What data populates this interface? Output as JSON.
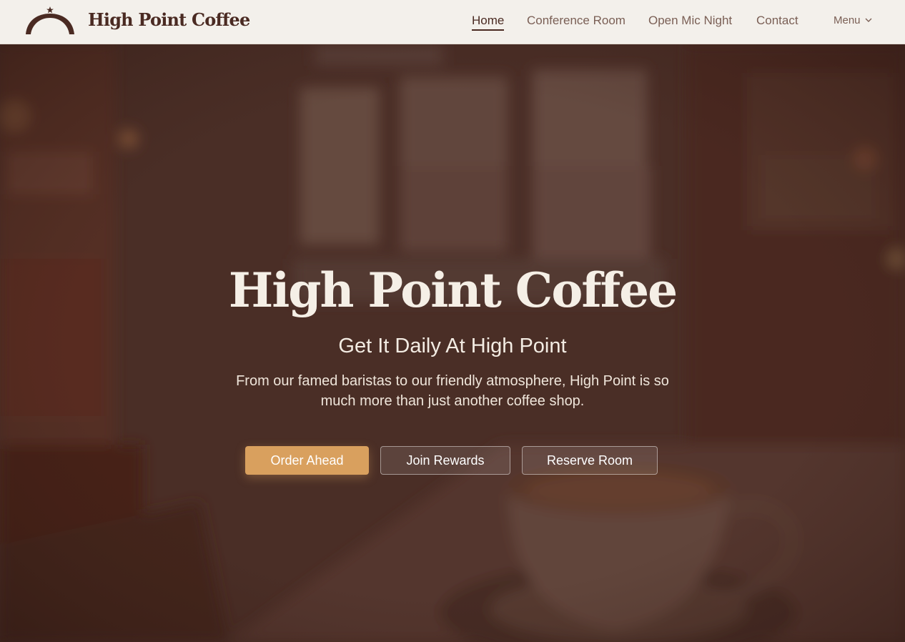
{
  "header": {
    "brand_name": "High Point Coffee",
    "logo_icon": "dome-star-logo-icon",
    "nav": [
      {
        "label": "Home",
        "active": true
      },
      {
        "label": "Conference Room",
        "active": false
      },
      {
        "label": "Open Mic Night",
        "active": false
      },
      {
        "label": "Contact",
        "active": false
      }
    ],
    "menu_label": "Menu",
    "menu_icon": "chevron-down-icon"
  },
  "hero": {
    "title": "High Point Coffee",
    "subtitle": "Get It Daily At High Point",
    "description": "From our famed baristas to our friendly atmosphere, High Point is so much more than just another coffee shop.",
    "buttons": {
      "order_ahead": "Order Ahead",
      "join_rewards": "Join Rewards",
      "reserve_room": "Reserve Room"
    }
  },
  "colors": {
    "brand": "#4a2a22",
    "accent": "#d9a05e",
    "header_bg": "#f3f0eb",
    "hero_overlay": "#4b3028"
  }
}
